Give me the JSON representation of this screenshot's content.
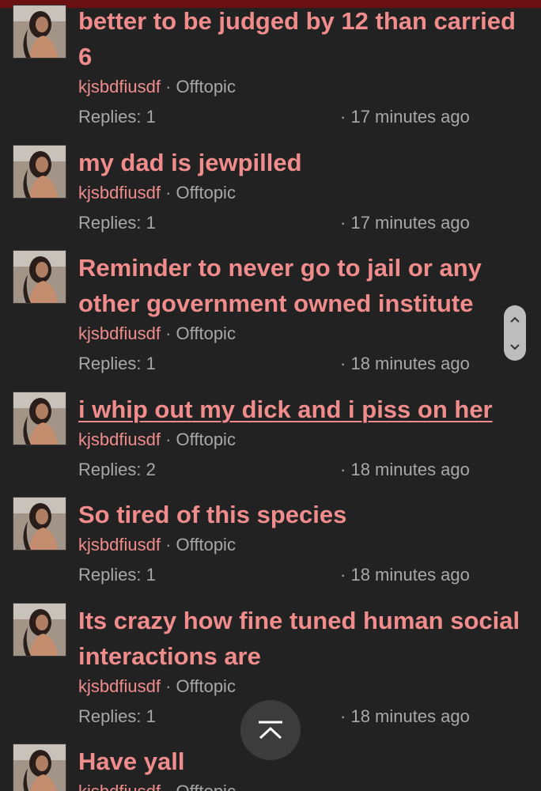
{
  "colors": {
    "background": "#222222",
    "accent": "#f08c8c",
    "muted": "#a8a8a8",
    "top_bar": "#6a0f12"
  },
  "threads": [
    {
      "title": "better to be judged by 12 than carried 6",
      "author": "kjsbdfiusdf",
      "board": "Offtopic",
      "replies": "Replies: 1",
      "time": "17 minutes ago"
    },
    {
      "title": "my dad is jewpilled",
      "author": "kjsbdfiusdf",
      "board": "Offtopic",
      "replies": "Replies: 1",
      "time": "17 minutes ago"
    },
    {
      "title": "Reminder to never go to jail or any other government owned institute",
      "author": "kjsbdfiusdf",
      "board": "Offtopic",
      "replies": "Replies: 1",
      "time": "18 minutes ago"
    },
    {
      "title": "i whip out my dick and i piss on her",
      "author": "kjsbdfiusdf",
      "board": "Offtopic",
      "replies": "Replies: 2",
      "time": "18 minutes ago"
    },
    {
      "title": "So tired of this species",
      "author": "kjsbdfiusdf",
      "board": "Offtopic",
      "replies": "Replies: 1",
      "time": "18 minutes ago"
    },
    {
      "title": "Its crazy how fine tuned human social interactions are",
      "author": "kjsbdfiusdf",
      "board": "Offtopic",
      "replies": "Replies: 1",
      "time": "18 minutes ago"
    },
    {
      "title": "Have yall",
      "author": "kjsbdfiusdf",
      "board": "Offtopic"
    }
  ],
  "separator": "·",
  "icons": {
    "scroll_up": "chevron-up-icon",
    "scroll_down": "chevron-down-icon",
    "back_to_top": "back-to-top-icon"
  }
}
